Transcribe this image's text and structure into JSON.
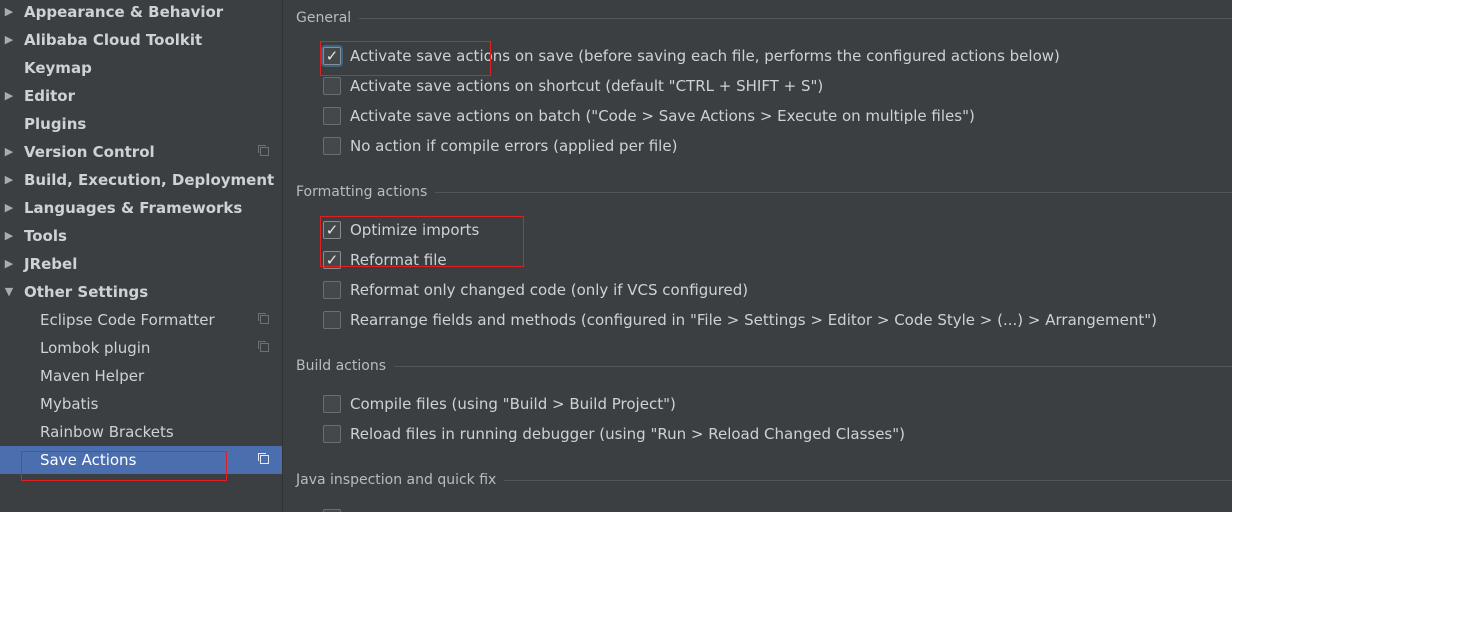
{
  "sidebar": {
    "items": [
      {
        "label": "Appearance & Behavior",
        "arrow": "▶"
      },
      {
        "label": "Alibaba Cloud Toolkit",
        "arrow": "▶"
      },
      {
        "label": "Keymap"
      },
      {
        "label": "Editor",
        "arrow": "▶"
      },
      {
        "label": "Plugins"
      },
      {
        "label": "Version Control",
        "arrow": "▶"
      },
      {
        "label": "Build, Execution, Deployment",
        "arrow": "▶"
      },
      {
        "label": "Languages & Frameworks",
        "arrow": "▶"
      },
      {
        "label": "Tools",
        "arrow": "▶"
      },
      {
        "label": "JRebel",
        "arrow": "▶"
      },
      {
        "label": "Other Settings",
        "arrow": "▼"
      },
      {
        "label": "Eclipse Code Formatter"
      },
      {
        "label": "Lombok plugin"
      },
      {
        "label": "Maven Helper"
      },
      {
        "label": "Mybatis"
      },
      {
        "label": "Rainbow Brackets"
      },
      {
        "label": "Save Actions",
        "selected": true
      }
    ]
  },
  "content": {
    "sections": [
      {
        "title": "General"
      },
      {
        "title": "Formatting actions"
      },
      {
        "title": "Build actions"
      },
      {
        "title": "Java inspection and quick fix"
      }
    ],
    "options": [
      {
        "label": "Activate save actions on save (before saving each file, performs the configured actions below)",
        "checked": true
      },
      {
        "label": "Activate save actions on shortcut (default \"CTRL + SHIFT + S\")",
        "checked": false
      },
      {
        "label": "Activate save actions on batch (\"Code > Save Actions > Execute on multiple files\")",
        "checked": false
      },
      {
        "label": "No action if compile errors (applied per file)",
        "checked": false
      },
      {
        "label": "Optimize imports",
        "checked": true
      },
      {
        "label": "Reformat file",
        "checked": true
      },
      {
        "label": "Reformat only changed code (only if VCS configured)",
        "checked": false
      },
      {
        "label": "Rearrange fields and methods (configured in \"File > Settings > Editor > Code Style > (...) > Arrangement\")",
        "checked": false
      },
      {
        "label": "Compile files (using \"Build > Build Project\")",
        "checked": false
      },
      {
        "label": "Reload files in running debugger (using \"Run > Reload Changed Classes\")",
        "checked": false
      }
    ],
    "checkmark": "✓"
  },
  "colors": {
    "window_bg": "#3c3f41",
    "selection": "#4b6eaf",
    "highlight_box": "#e02020"
  }
}
